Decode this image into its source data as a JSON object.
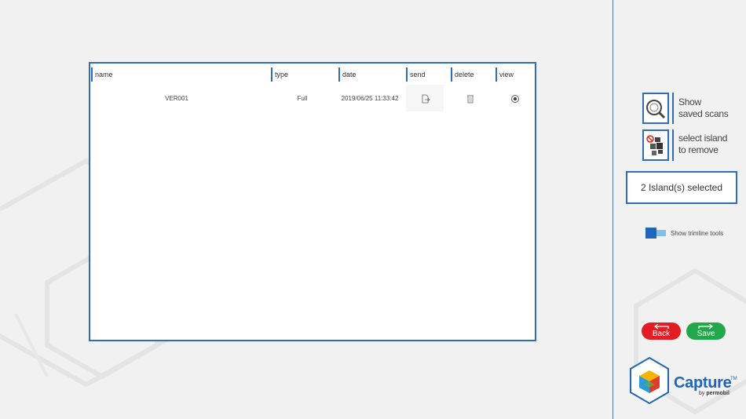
{
  "table": {
    "headers": [
      "name",
      "type",
      "date",
      "send",
      "delete",
      "view"
    ],
    "rows": [
      {
        "name": "VER001",
        "type": "Full",
        "date": "2019/06/25 11:33:42"
      }
    ]
  },
  "tools": {
    "show_scans": {
      "line1": "Show",
      "line2": "saved scans",
      "icon": "magnifier-icon"
    },
    "select_island": {
      "line1": "select island",
      "line2": "to remove",
      "icon": "island-blocks-icon"
    }
  },
  "status": {
    "text": "2 Island(s) selected"
  },
  "trimline": {
    "label": "Show trimline tools"
  },
  "actions": {
    "back_label": "Back",
    "save_label": "Save"
  },
  "logo": {
    "name": "Capture",
    "tm": "TM",
    "by": "by",
    "brand": "permobil"
  },
  "colors": {
    "accent": "#2f6db8",
    "back": "#e21e24",
    "save": "#21a84a",
    "background": "#f1f1f1"
  }
}
